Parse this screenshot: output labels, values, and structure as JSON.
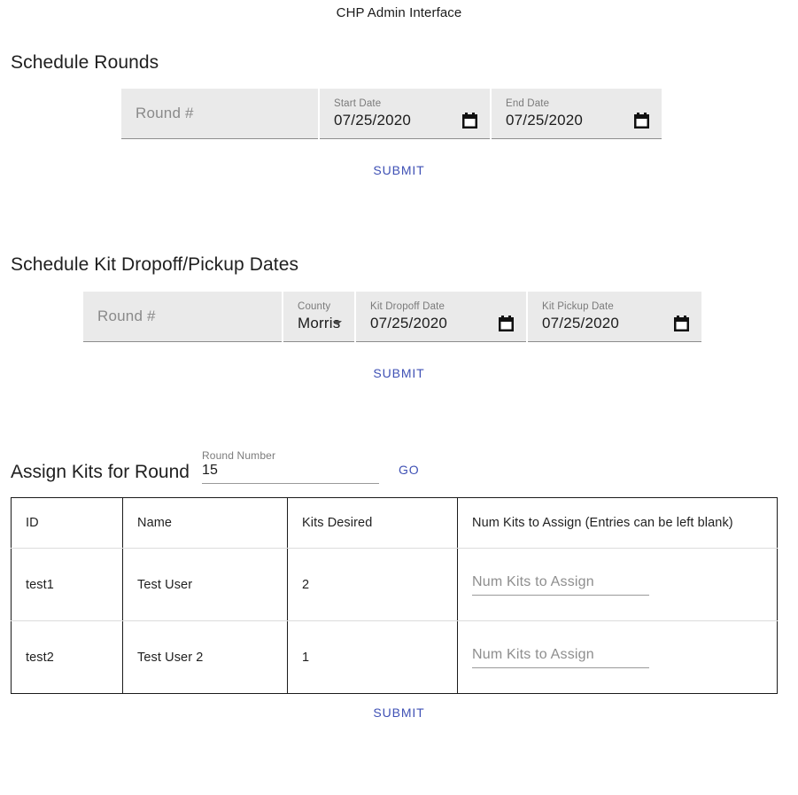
{
  "app": {
    "title": "CHP Admin Interface",
    "accent_color": "#3f51b5",
    "field_bg_color": "#eaeaea"
  },
  "schedule_rounds": {
    "heading": "Schedule Rounds",
    "round_placeholder": "Round #",
    "start_date": {
      "label": "Start Date",
      "value": "07/25/2020",
      "icon": "calendar-icon"
    },
    "end_date": {
      "label": "End Date",
      "value": "07/25/2020",
      "icon": "calendar-icon"
    },
    "submit_label": "SUBMIT"
  },
  "schedule_kits": {
    "heading": "Schedule Kit Dropoff/Pickup Dates",
    "round_placeholder": "Round #",
    "county": {
      "label": "County",
      "value": "Morris",
      "icon": "chevron-down-icon"
    },
    "dropoff_date": {
      "label": "Kit Dropoff Date",
      "value": "07/25/2020",
      "icon": "calendar-icon"
    },
    "pickup_date": {
      "label": "Kit Pickup Date",
      "value": "07/25/2020",
      "icon": "calendar-icon"
    },
    "submit_label": "SUBMIT"
  },
  "assign_kits": {
    "heading": "Assign Kits for Round",
    "round_number": {
      "label": "Round Number",
      "value": "15"
    },
    "go_label": "GO",
    "table": {
      "columns": [
        "ID",
        "Name",
        "Kits Desired",
        "Num Kits to Assign (Entries can be left blank)"
      ],
      "rows": [
        {
          "id": "test1",
          "name": "Test User",
          "kits_desired": "2",
          "assign_placeholder": "Num Kits to Assign",
          "assign_value": ""
        },
        {
          "id": "test2",
          "name": "Test User 2",
          "kits_desired": "1",
          "assign_placeholder": "Num Kits to Assign",
          "assign_value": ""
        }
      ]
    },
    "submit_label": "SUBMIT"
  }
}
